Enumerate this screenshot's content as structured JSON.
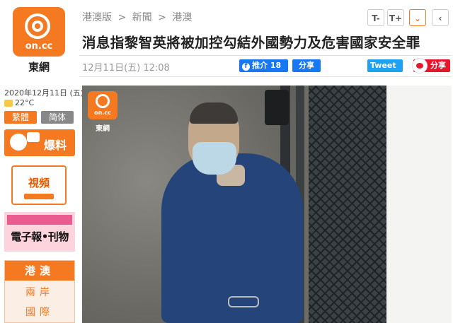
{
  "brand": {
    "logo_text": "on.cc",
    "logo_caption": "東網"
  },
  "breadcrumb": {
    "edition": "港澳版",
    "sep1": ">",
    "section": "新聞",
    "sep2": ">",
    "subsection": "港澳"
  },
  "toolbar": {
    "font_smaller": "T-",
    "font_larger": "T+",
    "expand": "⌄",
    "back": "‹"
  },
  "article": {
    "headline": "消息指黎智英將被加控勾結外國勢力及危害國家安全罪",
    "datetime": "12月11日(五) 12:08"
  },
  "share": {
    "facebook_label": "推介 18",
    "facebook_icon": "f",
    "share_label": "分享",
    "twitter_label": "Tweet",
    "weibo_label": "分享"
  },
  "sidebar": {
    "date": "2020年12月11日 (五)",
    "temperature": "22°C",
    "traditional": "繁體",
    "simplified": "简体",
    "baoliao": "爆料",
    "video": "視頻",
    "epaper": "電子報•刊物",
    "nav_header": "港澳",
    "nav_items": [
      "兩岸",
      "國際"
    ]
  },
  "photo": {
    "watermark_logo": "on.cc",
    "watermark_caption": "東網"
  },
  "colors": {
    "brand_orange": "#f47920",
    "facebook_blue": "#1877f2",
    "twitter_blue": "#1da1f2",
    "weibo_red": "#e6162d"
  }
}
